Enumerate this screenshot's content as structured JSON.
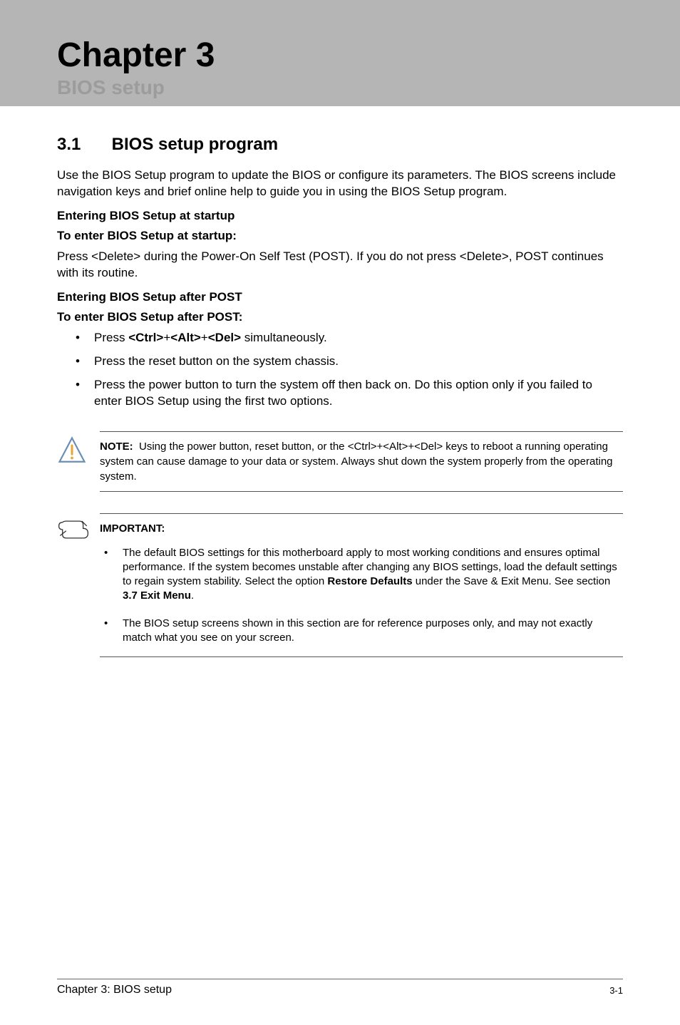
{
  "header": {
    "chapter_title": "Chapter 3",
    "chapter_subtitle": "BIOS setup"
  },
  "section": {
    "number": "3.1",
    "title": "BIOS setup program"
  },
  "intro_paragraph": "Use the BIOS Setup program to update the BIOS or configure its parameters. The BIOS screens include navigation keys and brief online help to guide you in using the BIOS Setup program.",
  "startup": {
    "heading1": "Entering BIOS Setup at startup",
    "heading2": "To enter BIOS Setup at startup:",
    "text": "Press <Delete> during the Power-On Self Test (POST). If you do not press <Delete>, POST continues with its routine."
  },
  "post": {
    "heading1": "Entering BIOS Setup after POST",
    "heading2": "To enter BIOS Setup after POST:",
    "bullets": [
      {
        "prefix": "Press ",
        "bold": "<Ctrl>",
        "mid1": "+",
        "bold2": "<Alt>",
        "mid2": "+",
        "bold3": "<Del>",
        "suffix": " simultaneously."
      },
      {
        "text": "Press the reset button on the system chassis."
      },
      {
        "text": "Press the power button to turn the system off then back on. Do this option only if you failed to enter BIOS Setup using the first two options."
      }
    ]
  },
  "note_callout": {
    "label": "NOTE:",
    "text": "Using the power button, reset button, or the <Ctrl>+<Alt>+<Del> keys to reboot a running operating system can cause damage to your data or system. Always shut down the system properly from the operating system."
  },
  "important_callout": {
    "label": "IMPORTANT:",
    "bullets": [
      {
        "pre": "The default BIOS settings for this motherboard apply to most working conditions and ensures optimal performance. If the system becomes unstable after changing any BIOS settings, load the default settings to regain system stability. Select the option ",
        "bold1": "Restore Defaults",
        "mid": " under the Save & Exit Menu. See section ",
        "bold2": "3.7 Exit Menu",
        "post": "."
      },
      {
        "text": "The BIOS setup screens shown in this section are for reference purposes only, and may not exactly match what you see on your screen."
      }
    ]
  },
  "footer": {
    "left": "Chapter 3: BIOS setup",
    "right": "3-1"
  }
}
